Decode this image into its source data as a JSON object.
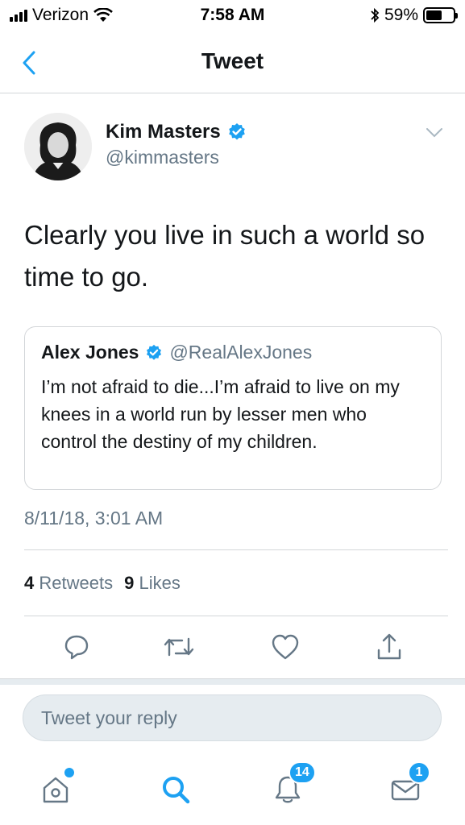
{
  "status": {
    "carrier": "Verizon",
    "time": "7:58 AM",
    "battery": "59%",
    "battery_level": 0.59
  },
  "nav": {
    "title": "Tweet"
  },
  "tweet": {
    "author_name": "Kim Masters",
    "author_handle": "@kimmasters",
    "text": "Clearly you live in such a world so time to go.",
    "timestamp": "8/11/18, 3:01 AM",
    "retweets_count": "4",
    "retweets_label": "Retweets",
    "likes_count": "9",
    "likes_label": "Likes"
  },
  "quote": {
    "name": "Alex Jones",
    "handle": "@RealAlexJones",
    "text": "I’m not afraid to die...I’m afraid to live on my knees in a world run by lesser men who control the destiny of my children."
  },
  "reply": {
    "placeholder": "Tweet your reply"
  },
  "tabbar": {
    "notifications_badge": "14",
    "messages_badge": "1"
  },
  "colors": {
    "accent": "#1da1f2",
    "secondary_text": "#657786",
    "divider": "#d3d6d9"
  }
}
